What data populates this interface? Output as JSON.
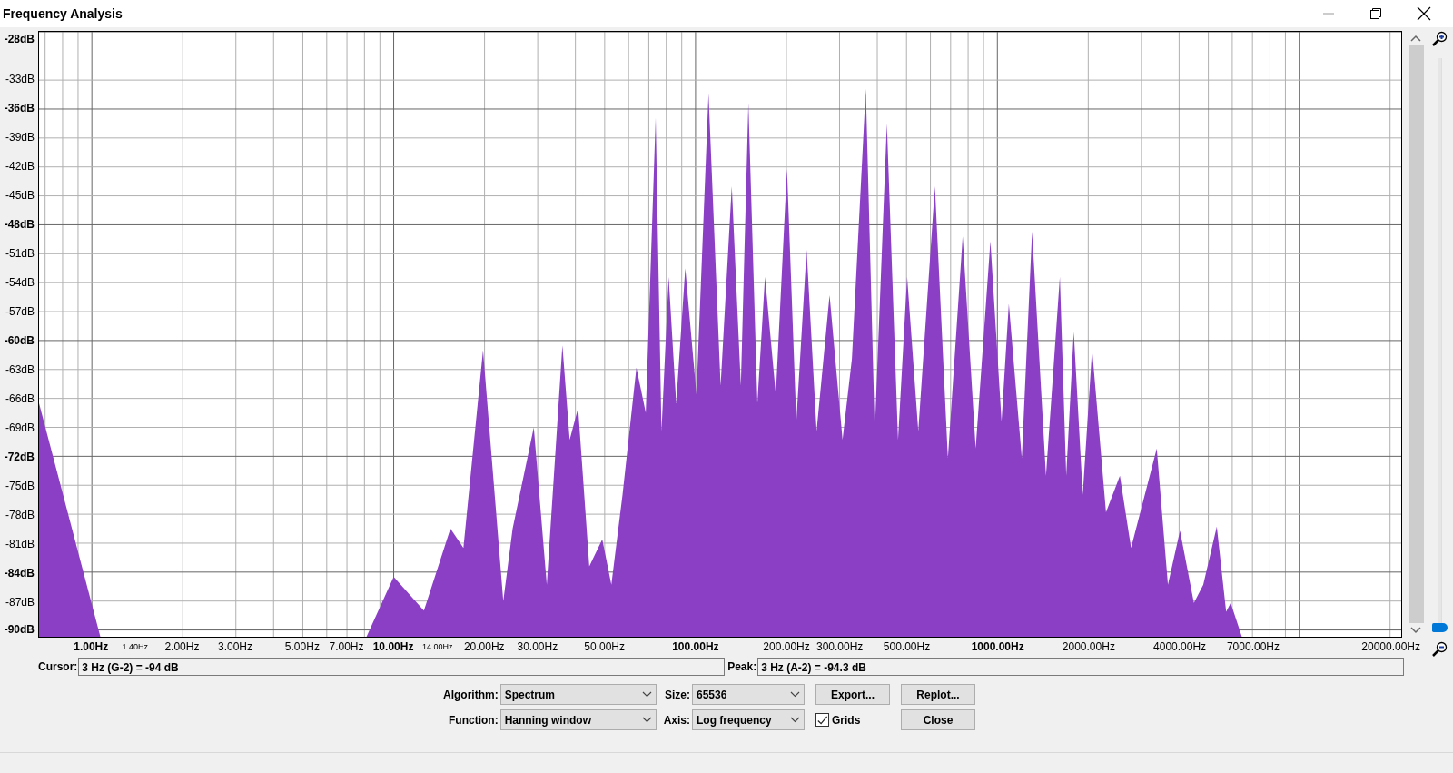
{
  "window": {
    "title": "Frequency Analysis"
  },
  "plot": {
    "y_labels": [
      {
        "label": "-28dB",
        "kind": "major"
      },
      {
        "label": "-33dB",
        "kind": "minor"
      },
      {
        "label": "-36dB",
        "kind": "major"
      },
      {
        "label": "-39dB",
        "kind": "minor"
      },
      {
        "label": "-42dB",
        "kind": "minor"
      },
      {
        "label": "-45dB",
        "kind": "minor"
      },
      {
        "label": "-48dB",
        "kind": "major"
      },
      {
        "label": "-51dB",
        "kind": "minor"
      },
      {
        "label": "-54dB",
        "kind": "minor"
      },
      {
        "label": "-57dB",
        "kind": "minor"
      },
      {
        "label": "-60dB",
        "kind": "major"
      },
      {
        "label": "-63dB",
        "kind": "minor"
      },
      {
        "label": "-66dB",
        "kind": "minor"
      },
      {
        "label": "-69dB",
        "kind": "minor"
      },
      {
        "label": "-72dB",
        "kind": "major"
      },
      {
        "label": "-75dB",
        "kind": "minor"
      },
      {
        "label": "-78dB",
        "kind": "minor"
      },
      {
        "label": "-81dB",
        "kind": "minor"
      },
      {
        "label": "-84dB",
        "kind": "major"
      },
      {
        "label": "-87dB",
        "kind": "minor"
      },
      {
        "label": "-90dB",
        "kind": "major"
      }
    ],
    "x_labels": [
      {
        "label": "1.00Hz",
        "kind": "major"
      },
      {
        "label": "1.40Hz",
        "kind": "small"
      },
      {
        "label": "2.00Hz",
        "kind": "minor"
      },
      {
        "label": "3.00Hz",
        "kind": "minor"
      },
      {
        "label": "5.00Hz",
        "kind": "minor"
      },
      {
        "label": "7.00Hz",
        "kind": "minor"
      },
      {
        "label": "10.00Hz",
        "kind": "major"
      },
      {
        "label": "14.00Hz",
        "kind": "small"
      },
      {
        "label": "20.00Hz",
        "kind": "minor"
      },
      {
        "label": "30.00Hz",
        "kind": "minor"
      },
      {
        "label": "50.00Hz",
        "kind": "minor"
      },
      {
        "label": "100.00Hz",
        "kind": "major"
      },
      {
        "label": "200.00Hz",
        "kind": "minor"
      },
      {
        "label": "300.00Hz",
        "kind": "minor"
      },
      {
        "label": "500.00Hz",
        "kind": "minor"
      },
      {
        "label": "1000.00Hz",
        "kind": "major"
      },
      {
        "label": "2000.00Hz",
        "kind": "minor"
      },
      {
        "label": "4000.00Hz",
        "kind": "minor"
      },
      {
        "label": "7000.00Hz",
        "kind": "minor"
      },
      {
        "label": "20000.00Hz",
        "kind": "minor"
      }
    ]
  },
  "zoom_slider": {
    "level": 0
  },
  "cursor": {
    "label": "Cursor:",
    "value": "3 Hz (G-2) = -94 dB"
  },
  "peak": {
    "label": "Peak:",
    "value": "3 Hz (A-2) = -94.3 dB"
  },
  "controls": {
    "algorithm": {
      "label": "Algorithm:",
      "value": "Spectrum"
    },
    "size": {
      "label": "Size:",
      "value": "65536"
    },
    "function": {
      "label": "Function:",
      "value": "Hanning window"
    },
    "axis": {
      "label": "Axis:",
      "value": "Log frequency"
    },
    "grids": {
      "label": "Grids",
      "checked": true
    },
    "buttons": [
      "Export...",
      "Replot...",
      "Close"
    ]
  }
}
